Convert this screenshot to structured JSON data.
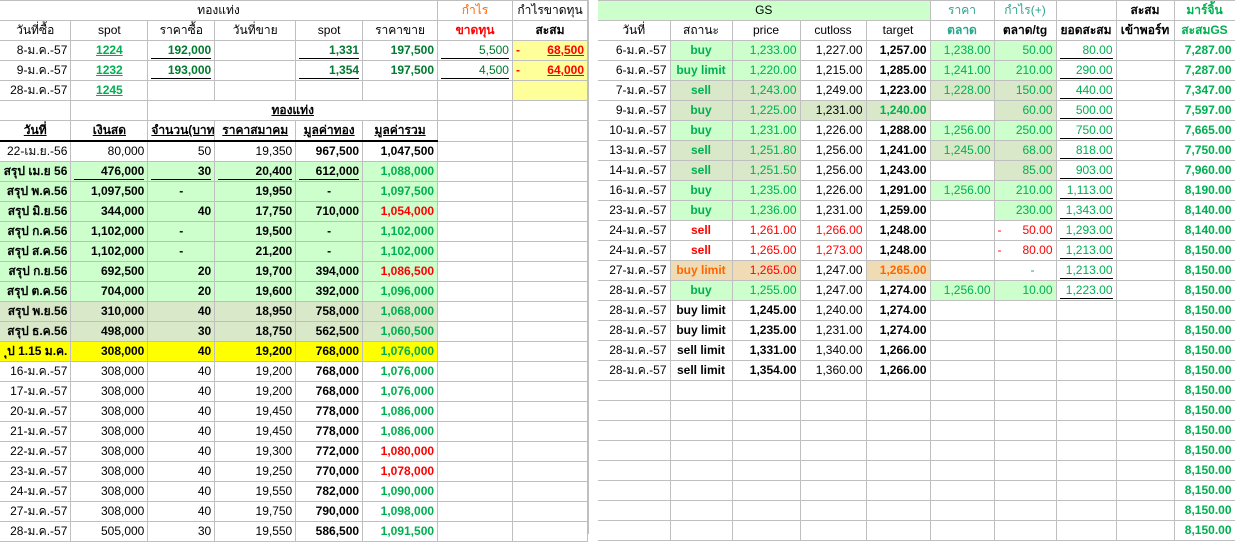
{
  "left": {
    "title_gold": "ทองแท่ง",
    "title_profit": "กำไร",
    "title_profit_loss": "กำไรขาดทุน",
    "h2": [
      "วันที่ซื้อ",
      "spot",
      "ราคาซื้อ",
      "วันที่ขาย",
      "spot",
      "ราคาขาย",
      "ขาดทุน",
      "สะสม"
    ],
    "trades": [
      {
        "date": "8-ม.ค.-57",
        "spot": "1224",
        "buy": "192,000",
        "sell_date": "",
        "sell_spot": "1,331",
        "sell_price": "197,500",
        "loss": "5,500",
        "cum_sign": "-",
        "cum": "68,500"
      },
      {
        "date": "9-ม.ค.-57",
        "spot": "1232",
        "buy": "193,000",
        "sell_date": "",
        "sell_spot": "1,354",
        "sell_price": "197,500",
        "loss": "4,500",
        "cum_sign": "-",
        "cum": "64,000"
      },
      {
        "date": "28-ม.ค.-57",
        "spot": "1245",
        "buy": "",
        "sell_date": "",
        "sell_spot": "",
        "sell_price": "",
        "loss": "",
        "cum_sign": "",
        "cum": ""
      }
    ],
    "gold_bar_title": "ทองแท่ง",
    "h5": [
      "วันที่",
      "เงินสด",
      "จำนวน(บาท)",
      "ราคาสมาคม",
      "มูลค่าทอง",
      "มูลค่ารวม"
    ],
    "rows": [
      {
        "date": "22-เม.ย.-56",
        "cash": "80,000",
        "qty": "50",
        "price": "19,350",
        "gold": "967,500",
        "total": "1,047,500",
        "tcolor": "black",
        "style": "plain"
      },
      {
        "date": "สรุป เม.ย 56",
        "cash": "476,000",
        "qty": "30",
        "price": "20,400",
        "gold": "612,000",
        "total": "1,088,000",
        "tcolor": "green",
        "style": "sumu"
      },
      {
        "date": "สรุป พ.ค.56",
        "cash": "1,097,500",
        "qty": "-",
        "price": "19,950",
        "gold": "-",
        "total": "1,097,500",
        "tcolor": "green",
        "style": "sum"
      },
      {
        "date": "สรุป มิ.ย.56",
        "cash": "344,000",
        "qty": "40",
        "price": "17,750",
        "gold": "710,000",
        "total": "1,054,000",
        "tcolor": "red",
        "style": "sum"
      },
      {
        "date": "สรุป ก.ค.56",
        "cash": "1,102,000",
        "qty": "-",
        "price": "19,500",
        "gold": "-",
        "total": "1,102,000",
        "tcolor": "green",
        "style": "sum"
      },
      {
        "date": "สรุป ส.ค.56",
        "cash": "1,102,000",
        "qty": "-",
        "price": "21,200",
        "gold": "-",
        "total": "1,102,000",
        "tcolor": "green",
        "style": "sum"
      },
      {
        "date": "สรุป ก.ย.56",
        "cash": "692,500",
        "qty": "20",
        "price": "19,700",
        "gold": "394,000",
        "total": "1,086,500",
        "tcolor": "red",
        "style": "sum"
      },
      {
        "date": "สรุป ต.ค.56",
        "cash": "704,000",
        "qty": "20",
        "price": "19,600",
        "gold": "392,000",
        "total": "1,096,000",
        "tcolor": "green",
        "style": "sum"
      },
      {
        "date": "สรุป พ.ย.56",
        "cash": "310,000",
        "qty": "40",
        "price": "18,950",
        "gold": "758,000",
        "total": "1,068,000",
        "tcolor": "green",
        "style": "tex"
      },
      {
        "date": "สรุป ธ.ค.56",
        "cash": "498,000",
        "qty": "30",
        "price": "18,750",
        "gold": "562,500",
        "total": "1,060,500",
        "tcolor": "green",
        "style": "tex"
      },
      {
        "date": "ุป 1.15 ม.ค.",
        "cash": "308,000",
        "qty": "40",
        "price": "19,200",
        "gold": "768,000",
        "total": "1,076,000",
        "tcolor": "green",
        "style": "yellow"
      },
      {
        "date": "16-ม.ค.-57",
        "cash": "308,000",
        "qty": "40",
        "price": "19,200",
        "gold": "768,000",
        "total": "1,076,000",
        "tcolor": "green",
        "style": "plain"
      },
      {
        "date": "17-ม.ค.-57",
        "cash": "308,000",
        "qty": "40",
        "price": "19,200",
        "gold": "768,000",
        "total": "1,076,000",
        "tcolor": "green",
        "style": "plain"
      },
      {
        "date": "20-ม.ค.-57",
        "cash": "308,000",
        "qty": "40",
        "price": "19,450",
        "gold": "778,000",
        "total": "1,086,000",
        "tcolor": "green",
        "style": "plain"
      },
      {
        "date": "21-ม.ค.-57",
        "cash": "308,000",
        "qty": "40",
        "price": "19,450",
        "gold": "778,000",
        "total": "1,086,000",
        "tcolor": "green",
        "style": "plain"
      },
      {
        "date": "22-ม.ค.-57",
        "cash": "308,000",
        "qty": "40",
        "price": "19,300",
        "gold": "772,000",
        "total": "1,080,000",
        "tcolor": "red",
        "style": "plain"
      },
      {
        "date": "23-ม.ค.-57",
        "cash": "308,000",
        "qty": "40",
        "price": "19,250",
        "gold": "770,000",
        "total": "1,078,000",
        "tcolor": "red",
        "style": "plain"
      },
      {
        "date": "24-ม.ค.-57",
        "cash": "308,000",
        "qty": "40",
        "price": "19,550",
        "gold": "782,000",
        "total": "1,090,000",
        "tcolor": "green",
        "style": "plain"
      },
      {
        "date": "27-ม.ค.-57",
        "cash": "308,000",
        "qty": "40",
        "price": "19,750",
        "gold": "790,000",
        "total": "1,098,000",
        "tcolor": "green",
        "style": "plain"
      },
      {
        "date": "28-ม.ค.-57",
        "cash": "505,000",
        "qty": "30",
        "price": "19,550",
        "gold": "586,500",
        "total": "1,091,500",
        "tcolor": "green",
        "style": "plain"
      }
    ]
  },
  "right": {
    "title_gs": "GS",
    "title_price": "ราคา",
    "title_profit": "กำไร(+)",
    "title_cum": "สะสม",
    "title_margin": "มาร์จิ้น",
    "h2": [
      "วันที่",
      "สถานะ",
      "price",
      "cutloss",
      "target",
      "ตลาด",
      "ตลาด/tg",
      "ยอดสะสม",
      "เข้าพอร์ท",
      "สะสมGS"
    ],
    "rows": [
      {
        "date": "6-ม.ค.-57",
        "status": "buy",
        "price": "1,233.00",
        "cut": "1,227.00",
        "target": "1,257.00",
        "market": "1,238.00",
        "mtg": "50.00",
        "msign": "",
        "cum": "80.00",
        "port": "",
        "gs": "7,287.00",
        "style": "green",
        "scolor": "green",
        "pcolor": "green",
        "ccolor": "black"
      },
      {
        "date": "6-ม.ค.-57",
        "status": "buy limit",
        "price": "1,220.00",
        "cut": "1,215.00",
        "target": "1,285.00",
        "market": "1,241.00",
        "mtg": "210.00",
        "msign": "",
        "cum": "290.00",
        "port": "",
        "gs": "7,287.00",
        "style": "green",
        "scolor": "green",
        "pcolor": "green",
        "ccolor": "black"
      },
      {
        "date": "7-ม.ค.-57",
        "status": "sell",
        "price": "1,243.00",
        "cut": "1,249.00",
        "target": "1,223.00",
        "market": "1,228.00",
        "mtg": "150.00",
        "msign": "",
        "cum": "440.00",
        "port": "",
        "gs": "7,347.00",
        "style": "tex",
        "scolor": "green",
        "pcolor": "green",
        "ccolor": "black"
      },
      {
        "date": "9-ม.ค.-57",
        "status": "buy",
        "price": "1,225.00",
        "cut": "1,231.00",
        "target": "1,240.00",
        "market": "",
        "mtg": "60.00",
        "msign": "",
        "cum": "500.00",
        "port": "",
        "gs": "7,597.00",
        "style": "tex",
        "scolor": "green",
        "pcolor": "green",
        "ccolor": "green"
      },
      {
        "date": "10-ม.ค.-57",
        "status": "buy",
        "price": "1,231.00",
        "cut": "1,226.00",
        "target": "1,288.00",
        "market": "1,256.00",
        "mtg": "250.00",
        "msign": "",
        "cum": "750.00",
        "port": "",
        "gs": "7,665.00",
        "style": "green",
        "scolor": "green",
        "pcolor": "green",
        "ccolor": "black"
      },
      {
        "date": "13-ม.ค.-57",
        "status": "sell",
        "price": "1,251.80",
        "cut": "1,256.00",
        "target": "1,241.00",
        "market": "1,245.00",
        "mtg": "68.00",
        "msign": "",
        "cum": "818.00",
        "port": "",
        "gs": "7,750.00",
        "style": "tex",
        "scolor": "green",
        "pcolor": "green",
        "ccolor": "black"
      },
      {
        "date": "14-ม.ค.-57",
        "status": "sell",
        "price": "1,251.50",
        "cut": "1,256.00",
        "target": "1,243.00",
        "market": "",
        "mtg": "85.00",
        "msign": "",
        "cum": "903.00",
        "port": "",
        "gs": "7,960.00",
        "style": "tex",
        "scolor": "green",
        "pcolor": "green",
        "ccolor": "black"
      },
      {
        "date": "16-ม.ค.-57",
        "status": "buy",
        "price": "1,235.00",
        "cut": "1,226.00",
        "target": "1,291.00",
        "market": "1,256.00",
        "mtg": "210.00",
        "msign": "",
        "cum": "1,113.00",
        "port": "",
        "gs": "8,190.00",
        "style": "green",
        "scolor": "green",
        "pcolor": "green",
        "ccolor": "black"
      },
      {
        "date": "23-ม.ค.-57",
        "status": "buy",
        "price": "1,236.00",
        "cut": "1,231.00",
        "target": "1,259.00",
        "market": "",
        "mtg": "230.00",
        "msign": "",
        "cum": "1,343.00",
        "port": "",
        "gs": "8,140.00",
        "style": "green",
        "scolor": "green",
        "pcolor": "green",
        "ccolor": "black"
      },
      {
        "date": "24-ม.ค.-57",
        "status": "sell",
        "price": "1,261.00",
        "cut": "1,266.00",
        "target": "1,248.00",
        "market": "",
        "mtg": "50.00",
        "msign": "-",
        "cum": "1,293.00",
        "port": "",
        "gs": "8,140.00",
        "style": "plain",
        "scolor": "red",
        "pcolor": "red",
        "ccolor": "red"
      },
      {
        "date": "24-ม.ค.-57",
        "status": "sell",
        "price": "1,265.00",
        "cut": "1,273.00",
        "target": "1,248.00",
        "market": "",
        "mtg": "80.00",
        "msign": "-",
        "cum": "1,213.00",
        "port": "",
        "gs": "8,150.00",
        "style": "plain",
        "scolor": "red",
        "pcolor": "red",
        "ccolor": "red"
      },
      {
        "date": "27-ม.ค.-57",
        "status": "buy limit",
        "price": "1,265.00",
        "cut": "1,247.00",
        "target": "1,265.00",
        "market": "",
        "mtg": "-",
        "msign": "",
        "cum": "1,213.00",
        "port": "",
        "gs": "8,150.00",
        "style": "tan",
        "scolor": "orange",
        "pcolor": "red",
        "ccolor": "black"
      },
      {
        "date": "28-ม.ค.-57",
        "status": "buy",
        "price": "1,255.00",
        "cut": "1,247.00",
        "target": "1,274.00",
        "market": "1,256.00",
        "mtg": "10.00",
        "msign": "",
        "cum": "1,223.00",
        "port": "",
        "gs": "8,150.00",
        "style": "green",
        "scolor": "green",
        "pcolor": "green",
        "ccolor": "black"
      },
      {
        "date": "28-ม.ค.-57",
        "status": "buy limit",
        "price": "1,245.00",
        "cut": "1,240.00",
        "target": "1,274.00",
        "market": "",
        "mtg": "",
        "msign": "",
        "cum": "",
        "port": "",
        "gs": "8,150.00",
        "style": "plain",
        "scolor": "black",
        "pcolor": "black",
        "ccolor": "black"
      },
      {
        "date": "28-ม.ค.-57",
        "status": "buy limit",
        "price": "1,235.00",
        "cut": "1,231.00",
        "target": "1,274.00",
        "market": "",
        "mtg": "",
        "msign": "",
        "cum": "",
        "port": "",
        "gs": "8,150.00",
        "style": "plain",
        "scolor": "black",
        "pcolor": "black",
        "ccolor": "black"
      },
      {
        "date": "28-ม.ค.-57",
        "status": "sell limit",
        "price": "1,331.00",
        "cut": "1,340.00",
        "target": "1,266.00",
        "market": "",
        "mtg": "",
        "msign": "",
        "cum": "",
        "port": "",
        "gs": "8,150.00",
        "style": "plain",
        "scolor": "black",
        "pcolor": "black",
        "ccolor": "black"
      },
      {
        "date": "28-ม.ค.-57",
        "status": "sell limit",
        "price": "1,354.00",
        "cut": "1,360.00",
        "target": "1,266.00",
        "market": "",
        "mtg": "",
        "msign": "",
        "cum": "",
        "port": "",
        "gs": "8,150.00",
        "style": "plain",
        "scolor": "black",
        "pcolor": "black",
        "ccolor": "black"
      }
    ],
    "empty_gs": [
      "8,150.00",
      "8,150.00",
      "8,150.00",
      "8,150.00",
      "8,150.00",
      "8,150.00",
      "8,150.00",
      "8,150.00"
    ]
  }
}
